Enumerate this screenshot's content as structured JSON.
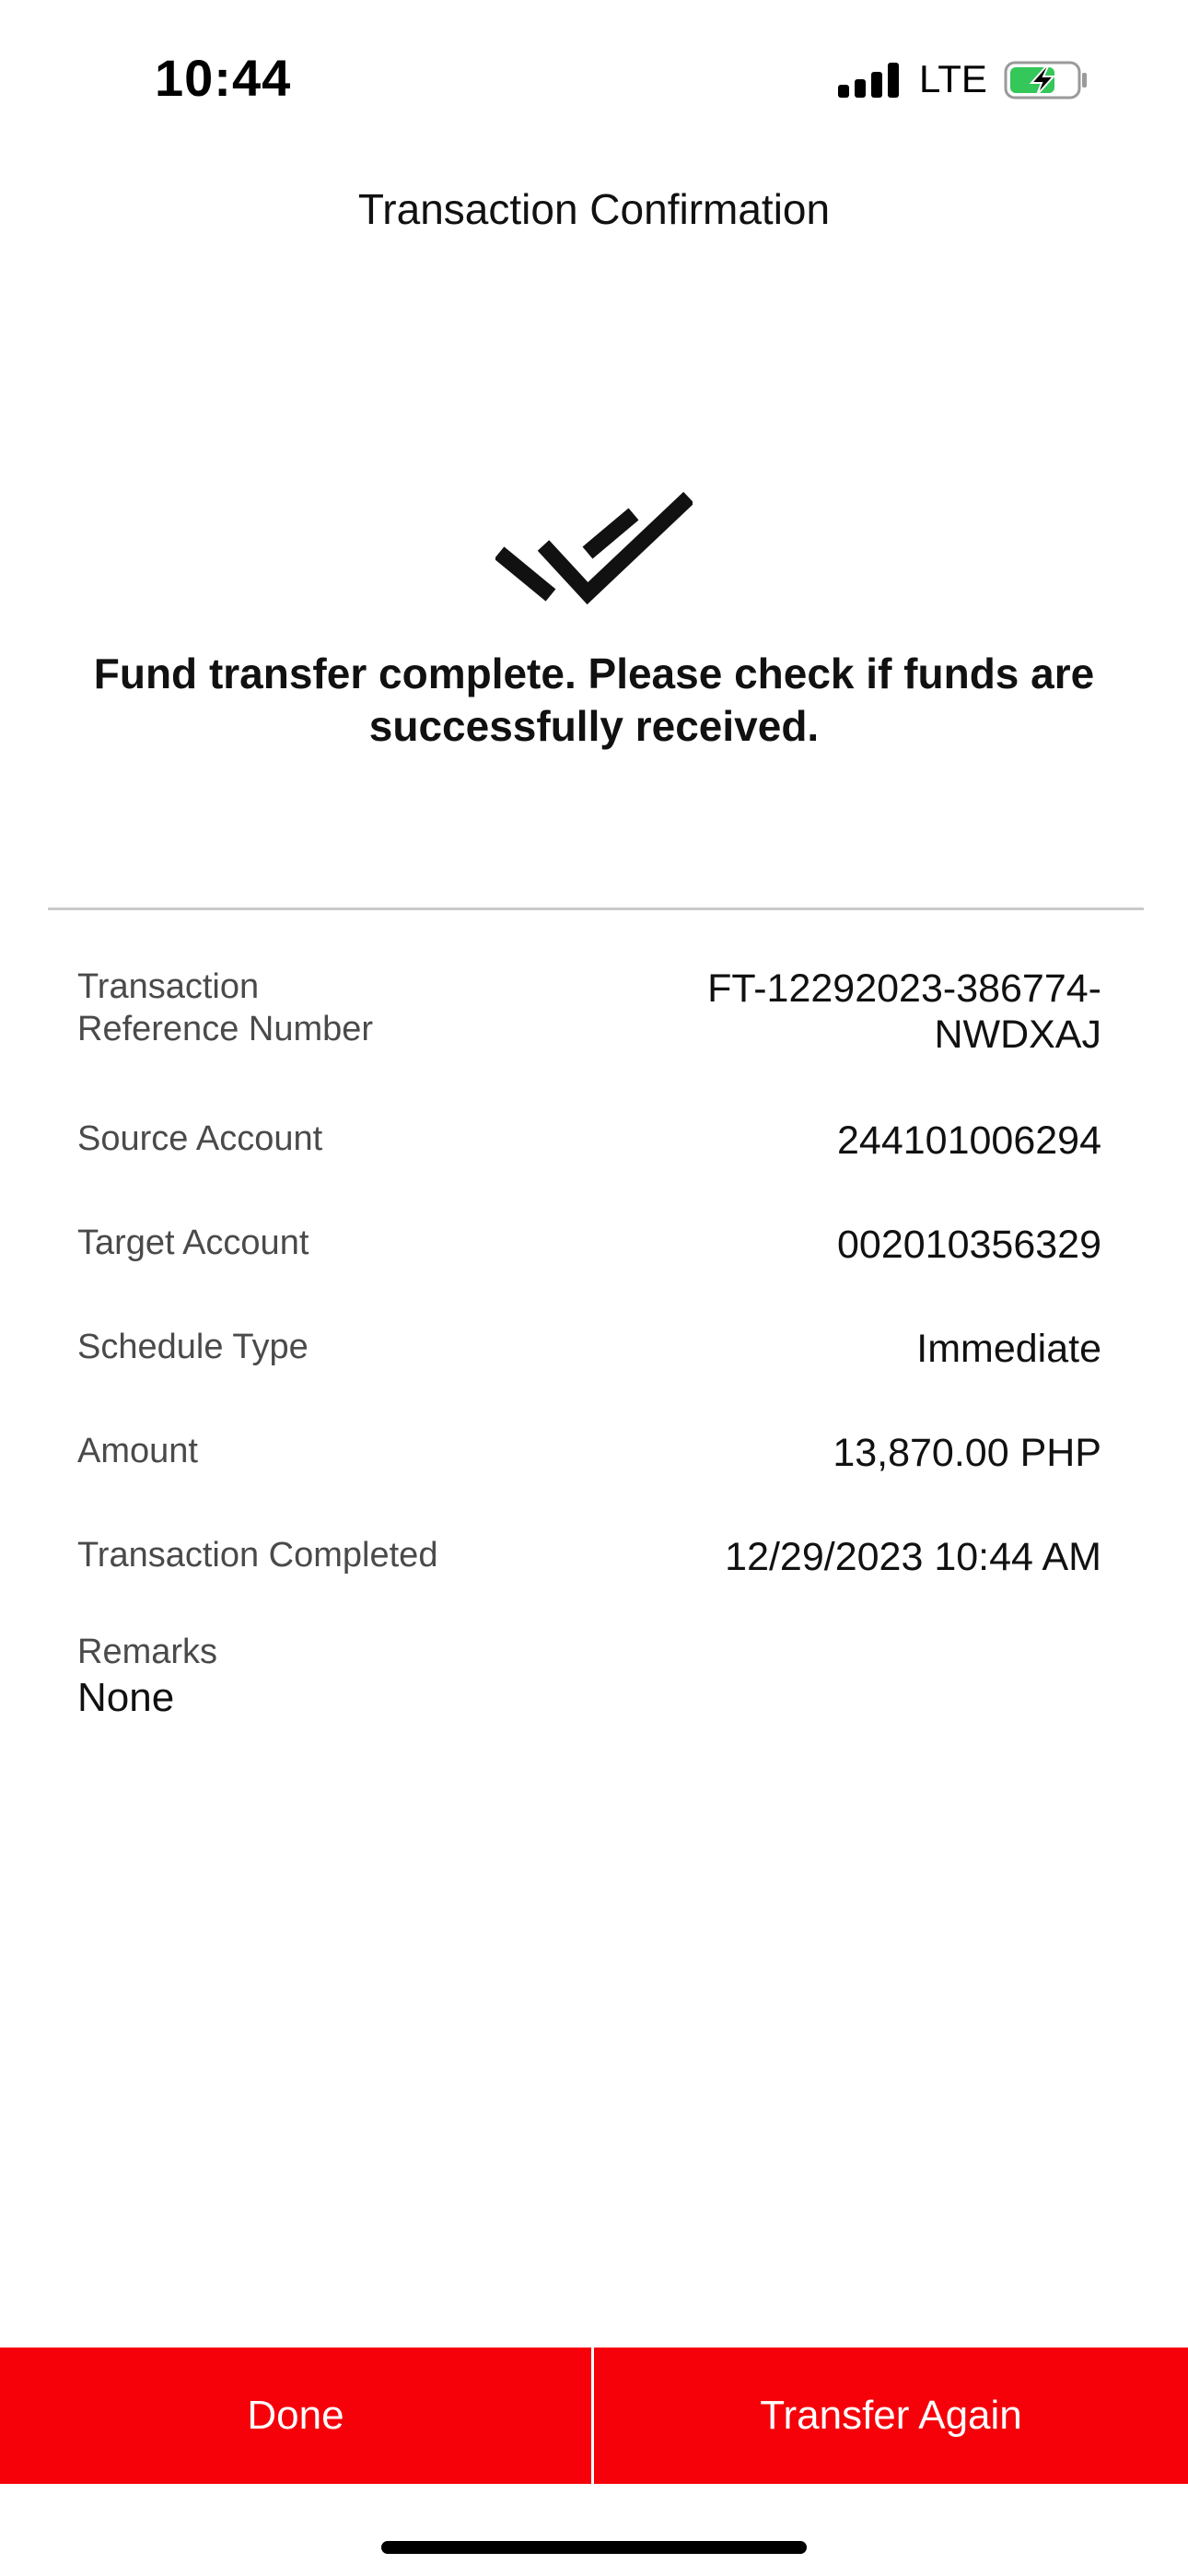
{
  "status_bar": {
    "time": "10:44",
    "network": "LTE",
    "icons": [
      "signal-icon",
      "battery-charging-icon"
    ]
  },
  "header": {
    "title": "Transaction Confirmation"
  },
  "success": {
    "icon": "double-check-icon",
    "message": "Fund transfer complete. Please check if funds are successfully received."
  },
  "details": {
    "reference": {
      "label_line1": "Transaction",
      "label_line2": "Reference Number",
      "value_line1": "FT-12292023-386774-",
      "value_line2": "NWDXAJ"
    },
    "source_account": {
      "label": "Source Account",
      "value": "244101006294"
    },
    "target_account": {
      "label": "Target Account",
      "value": "002010356329"
    },
    "schedule_type": {
      "label": "Schedule Type",
      "value": "Immediate"
    },
    "amount": {
      "label": "Amount",
      "value": "13,870.00 PHP"
    },
    "completed": {
      "label": "Transaction Completed",
      "value": "12/29/2023 10:44 AM"
    },
    "remarks": {
      "label": "Remarks",
      "value": "None"
    }
  },
  "actions": {
    "done_label": "Done",
    "transfer_again_label": "Transfer Again"
  },
  "colors": {
    "accent": "#f6000a",
    "battery_green": "#34c759",
    "divider": "#c9c9c9"
  }
}
